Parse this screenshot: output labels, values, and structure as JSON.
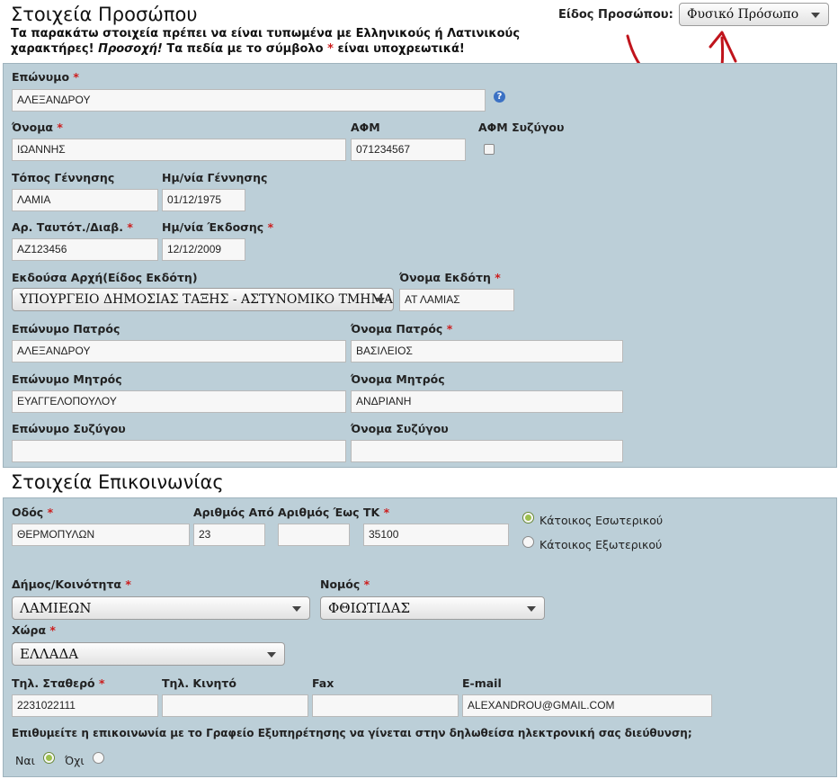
{
  "personal": {
    "title": "Στοιχεία Προσώπου",
    "note_line1": "Τα παρακάτω στοιχεία πρέπει να είναι τυπωμένα με Ελληνικούς ή Λατινικούς",
    "note_line2_a": "χαρακτήρες!",
    "note_line2_em": "Προσοχή!",
    "note_line2_b": "Τα πεδία με το σύμβολο",
    "note_star": "*",
    "note_line2_c": "είναι υποχρεωτικά!",
    "person_type_label": "Είδος Προσώπου:",
    "person_type_value": "Φυσικό Πρόσωπο",
    "fields": {
      "surname": {
        "label": "Επώνυμο",
        "value": "ΑΛΕΞΑΝΔΡΟΥ"
      },
      "name": {
        "label": "Όνομα",
        "value": "ΙΩΑΝΝΗΣ"
      },
      "afm": {
        "label": "ΑΦΜ",
        "value": "071234567"
      },
      "afm_spouse": {
        "label": "ΑΦΜ Συζύγου"
      },
      "birth_place": {
        "label": "Τόπος Γέννησης",
        "value": "ΛΑΜΙΑ"
      },
      "birth_date": {
        "label": "Ημ/νία Γέννησης",
        "value": "01/12/1975"
      },
      "id_number": {
        "label": "Αρ. Ταυτότ./Διαβ.",
        "value": "ΑΖ123456"
      },
      "issue_date": {
        "label": "Ημ/νία Έκδοσης",
        "value": "12/12/2009"
      },
      "issuing_authority": {
        "label": "Εκδούσα Αρχή(Είδος Εκδότη)",
        "value": "ΥΠΟΥΡΓΕΙΟ ΔΗΜΟΣΙΑΣ ΤΑΞΗΣ - ΑΣΤΥΝΟΜΙΚΟ ΤΜΗΜΑ"
      },
      "issuer_name": {
        "label": "Όνομα Εκδότη",
        "value": "ΑΤ ΛΑΜΙΑΣ"
      },
      "father_surname": {
        "label": "Επώνυμο Πατρός",
        "value": "ΑΛΕΞΑΝΔΡΟΥ"
      },
      "father_name": {
        "label": "Όνομα Πατρός",
        "value": "ΒΑΣΙΛΕΙΟΣ"
      },
      "mother_surname": {
        "label": "Επώνυμο Μητρός",
        "value": "ΕΥΑΓΓΕΛΟΠΟΥΛΟΥ"
      },
      "mother_name": {
        "label": "Όνομα Μητρός",
        "value": "ΑΝΔΡΙΑΝΗ"
      },
      "spouse_surname": {
        "label": "Επώνυμο Συζύγου",
        "value": ""
      },
      "spouse_name": {
        "label": "Όνομα Συζύγου",
        "value": ""
      }
    },
    "required_mark": "*"
  },
  "contact": {
    "title": "Στοιχεία Επικοινωνίας",
    "fields": {
      "street": {
        "label": "Οδός",
        "value": "ΘΕΡΜΟΠΥΛΩΝ"
      },
      "number_from": {
        "label": "Αριθμός Από",
        "value": "23"
      },
      "number_to": {
        "label": "Αριθμός Έως",
        "value": ""
      },
      "postal_code": {
        "label": "ΤΚ",
        "value": "35100"
      },
      "municipality": {
        "label": "Δήμος/Κοινότητα",
        "value": "ΛΑΜΙΕΩΝ"
      },
      "prefecture": {
        "label": "Νομός",
        "value": "ΦΘΙΩΤΙΔΑΣ"
      },
      "country": {
        "label": "Χώρα",
        "value": "ΕΛΛΑΔΑ"
      },
      "phone": {
        "label": "Τηλ. Σταθερό",
        "value": "2231022111"
      },
      "mobile": {
        "label": "Τηλ. Κινητό",
        "value": ""
      },
      "fax": {
        "label": "Fax",
        "value": ""
      },
      "email": {
        "label": "E-mail",
        "value": "ALEXANDROU@GMAIL.COM"
      }
    },
    "residence": {
      "domestic": "Κάτοικος Εσωτερικού",
      "abroad": "Κάτοικος Εξωτερικού",
      "selected": "domestic"
    },
    "email_question": "Επιθυμείτε η επικοινωνία με το Γραφείο Εξυπηρέτησης να γίνεται στην δηλωθείσα ηλεκτρονική σας διεύθυνση;",
    "yes_label": "Ναι",
    "no_label": "Όχι",
    "email_consent": "yes"
  },
  "colors": {
    "panel": "#bccfd8",
    "required": "#cc1d1d",
    "annotation": "#c0141c"
  },
  "icons": {
    "help": "help-icon",
    "dropdown": "chevron-down-icon"
  }
}
